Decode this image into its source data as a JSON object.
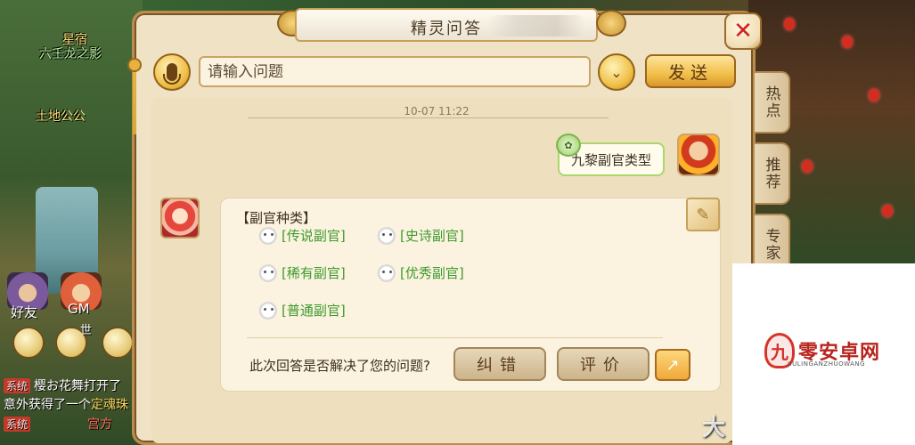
{
  "dialog": {
    "title": "精灵问答",
    "search": {
      "placeholder": "请输入问题",
      "value": ""
    },
    "send_label": "发送",
    "timestamp": "10-07 11:22",
    "user_message": "九黎副官类型",
    "answer": {
      "heading": "【副官种类】",
      "links": [
        {
          "label": "[传说副官]"
        },
        {
          "label": "[史诗副官]"
        },
        {
          "label": "[稀有副官]"
        },
        {
          "label": "[优秀副官]"
        },
        {
          "label": "[普通副官]"
        }
      ]
    },
    "feedback": {
      "question": "此次回答是否解决了您的问题?",
      "correct_label": "纠错",
      "rate_label": "评价"
    },
    "side_tabs": [
      {
        "label": "热点"
      },
      {
        "label": "推荐"
      },
      {
        "label": "专家"
      }
    ]
  },
  "background": {
    "char_name_1": "星宿",
    "char_name_2": "六壬龙之影",
    "char_name_3": "土地公公",
    "friend_label": "好友",
    "gm_label": "GM",
    "world_label": "世",
    "chat": [
      {
        "tag": "系统",
        "text": "樱お花舞打开了"
      },
      {
        "tag": "",
        "text": "意外获得了一个",
        "hi": "定魂珠"
      },
      {
        "tag": "系统",
        "text": "",
        "red": "宫方"
      }
    ]
  },
  "watermark": {
    "logo_glyph": "九",
    "name": "零安卓网",
    "sub": "JIULINGANZHUOWANG",
    "corner_text": "大"
  }
}
